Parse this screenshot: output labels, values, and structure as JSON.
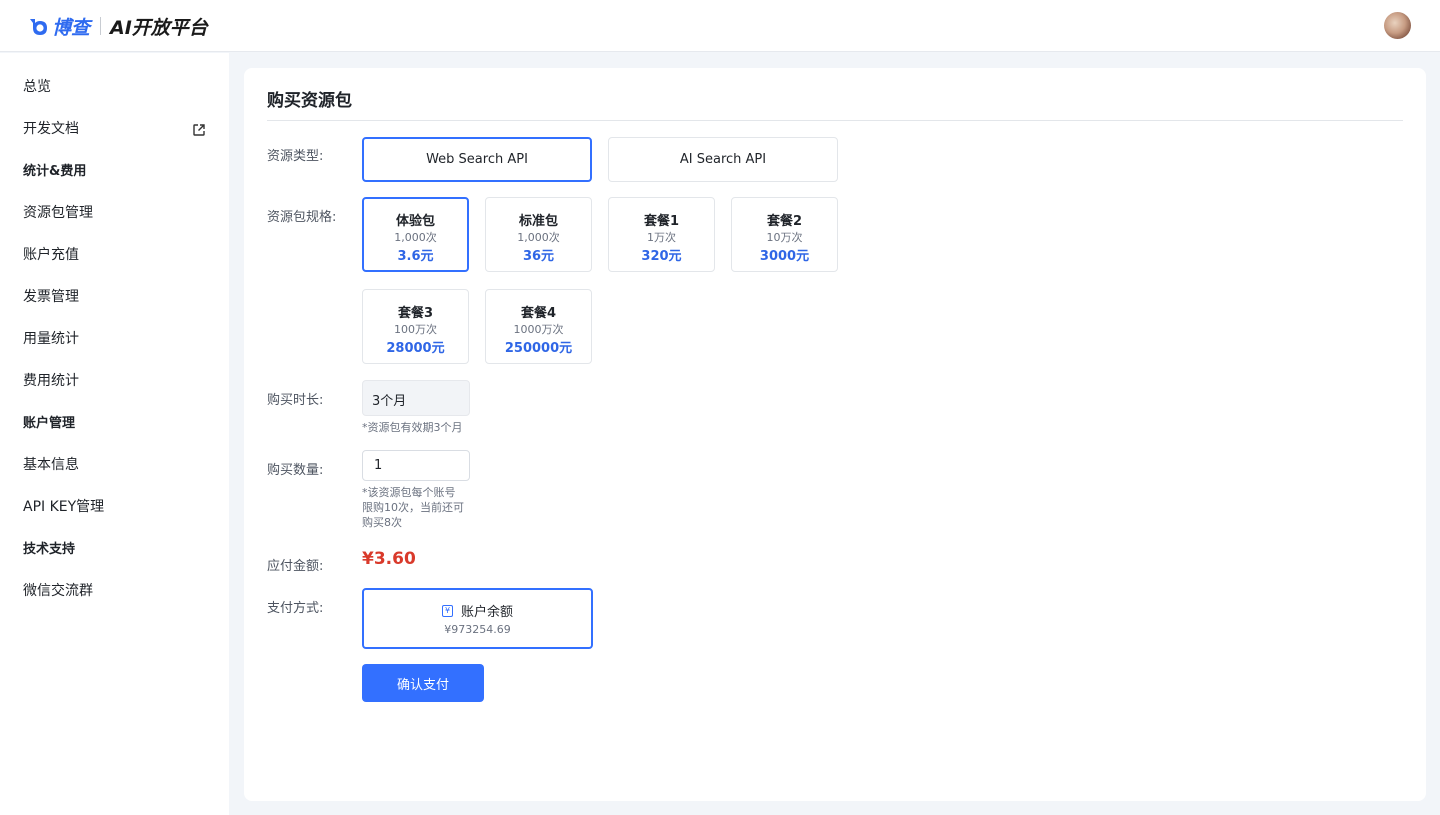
{
  "header": {
    "brand": "博查",
    "title": "AI开放平台",
    "avatar_icon": "user-avatar"
  },
  "sidebar": {
    "overview": "总览",
    "dev_docs": "开发文档",
    "group_stats": "统计&费用",
    "pkg_manage": "资源包管理",
    "recharge": "账户充值",
    "invoice": "发票管理",
    "usage": "用量统计",
    "cost": "费用统计",
    "group_account": "账户管理",
    "basic_info": "基本信息",
    "api_key": "API KEY管理",
    "group_support": "技术支持",
    "wechat": "微信交流群"
  },
  "main": {
    "title": "购买资源包",
    "labels": {
      "type": "资源类型:",
      "spec": "资源包规格:",
      "duration": "购买时长:",
      "quantity": "购买数量:",
      "amount": "应付金额:",
      "payment": "支付方式:"
    },
    "types": [
      {
        "label": "Web Search API",
        "selected": true
      },
      {
        "label": "AI Search API",
        "selected": false
      }
    ],
    "packages": [
      {
        "name": "体验包",
        "count": "1,000次",
        "price": "3.6元",
        "selected": true
      },
      {
        "name": "标准包",
        "count": "1,000次",
        "price": "36元",
        "selected": false
      },
      {
        "name": "套餐1",
        "count": "1万次",
        "price": "320元",
        "selected": false
      },
      {
        "name": "套餐2",
        "count": "10万次",
        "price": "3000元",
        "selected": false
      },
      {
        "name": "套餐3",
        "count": "100万次",
        "price": "28000元",
        "selected": false
      },
      {
        "name": "套餐4",
        "count": "1000万次",
        "price": "250000元",
        "selected": false
      }
    ],
    "duration_value": "3个月",
    "duration_hint": "*资源包有效期3个月",
    "quantity_value": "1",
    "quantity_hint": [
      "*该资源包每个账号",
      "限购10次，当前还可",
      "购买8次"
    ],
    "amount": "¥3.60",
    "payment": {
      "name": "账户余额",
      "balance": "¥973254.69",
      "icon": "yen-wallet-icon",
      "symbol": "¥"
    },
    "confirm_label": "确认支付"
  },
  "colors": {
    "accent": "#3370ff",
    "price": "#2f66e6",
    "amount": "#d93a2b"
  }
}
